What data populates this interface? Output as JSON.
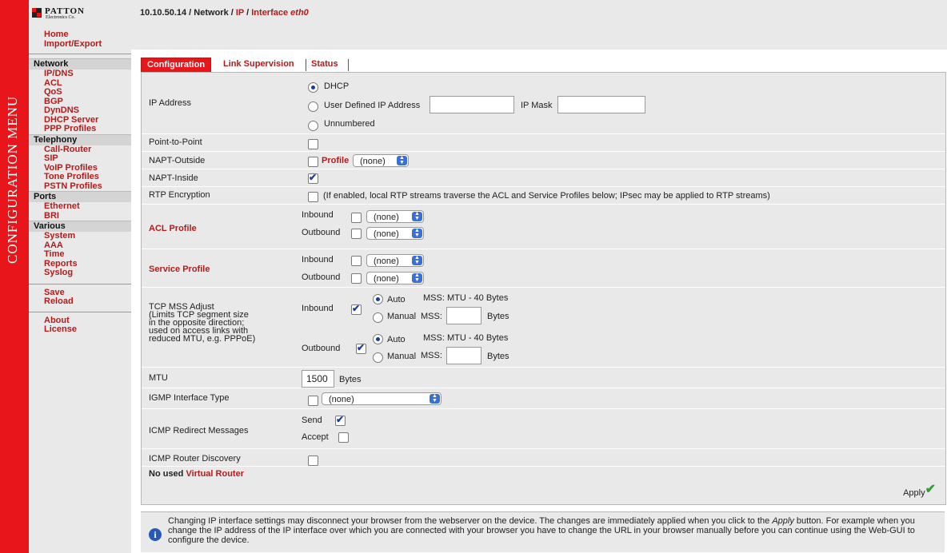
{
  "sidebar": {
    "vertical_title": "CONFIGURATION MENU",
    "logo": {
      "name": "PATTON",
      "sub": "Electronics Co."
    },
    "top_links": [
      "Home",
      "Import/Export"
    ],
    "network_header": "Network",
    "network": [
      "IP/DNS",
      "ACL",
      "QoS",
      "BGP",
      "DynDNS",
      "DHCP Server",
      "PPP Profiles"
    ],
    "telephony_header": "Telephony",
    "telephony": [
      "Call-Router",
      "SIP",
      "VoIP Profiles",
      "Tone Profiles",
      "PSTN Profiles"
    ],
    "ports_header": "Ports",
    "ports": [
      "Ethernet",
      "BRI"
    ],
    "various_header": "Various",
    "various": [
      "System",
      "AAA",
      "Time",
      "Reports",
      "Syslog"
    ],
    "save": "Save",
    "reload": "Reload",
    "about": "About",
    "license": "License"
  },
  "breadcrumb": {
    "host": "10.10.50.14",
    "sep1": " / ",
    "network": "Network",
    "sep2": " / ",
    "ip": "IP",
    "sep3": " / ",
    "iface_prefix": "Interface ",
    "iface": "eth0"
  },
  "tabs": [
    {
      "label": "Configuration",
      "active": true
    },
    {
      "label": "Link Supervision",
      "active": false
    },
    {
      "label": "Status",
      "active": false
    }
  ],
  "form": {
    "ip_address": {
      "label": "IP Address",
      "dhcp": "DHCP",
      "user_defined": "User Defined IP Address",
      "ip_mask": "IP Mask",
      "unnumbered": "Unnumbered",
      "ip_value": "",
      "mask_value": ""
    },
    "ptp": {
      "label": "Point-to-Point",
      "checked": false
    },
    "napt_outside": {
      "label": "NAPT-Outside",
      "profile": "Profile",
      "value": "(none)",
      "checked": false
    },
    "napt_inside": {
      "label": "NAPT-Inside",
      "checked": true
    },
    "rtp": {
      "label": "RTP Encryption",
      "note": "(If enabled, local RTP streams traverse the ACL and Service Profiles below; IPsec may be applied to RTP streams)"
    },
    "acl": {
      "label": "ACL Profile",
      "inbound": "Inbound",
      "outbound": "Outbound",
      "in_value": "(none)",
      "out_value": "(none)"
    },
    "service": {
      "label": "Service Profile",
      "inbound": "Inbound",
      "outbound": "Outbound",
      "in_value": "(none)",
      "out_value": "(none)"
    },
    "mss": {
      "label_lines": [
        "TCP MSS Adjust",
        "(Limits TCP segment size",
        "in the opposite direction;",
        "used on access links with",
        "reduced MTU, e.g. PPPoE)"
      ],
      "inbound": "Inbound",
      "outbound": "Outbound",
      "auto": "Auto",
      "manual": "Manual",
      "mss": "MSS:",
      "bytes": "Bytes",
      "auto_note": "MSS: MTU - 40 Bytes"
    },
    "mtu": {
      "label": "MTU",
      "value": "1500",
      "unit": "Bytes"
    },
    "igmp": {
      "label": "IGMP Interface Type",
      "value": "(none)"
    },
    "icmp_redirect": {
      "label": "ICMP Redirect Messages",
      "send": "Send",
      "accept": "Accept"
    },
    "icmp_router": {
      "label": "ICMP Router Discovery"
    },
    "vrouter": {
      "prefix": "No used ",
      "link": "Virtual Router"
    },
    "apply": "Apply"
  },
  "info": {
    "text_1": "Changing IP interface settings may disconnect your browser from the webserver on the device. The changes are immediately applied when you click to the ",
    "apply_word": "Apply",
    "text_2": " button. For example when you change the IP address of the IP interface over which you are connected with your browser you have to change the URL in your browser manually before you can continue using the Web-GUI to configure the device."
  },
  "colors": {
    "brand_red": "#e8151a",
    "link_red": "#b31b1b",
    "panel_bg": "#e9e9e9"
  }
}
